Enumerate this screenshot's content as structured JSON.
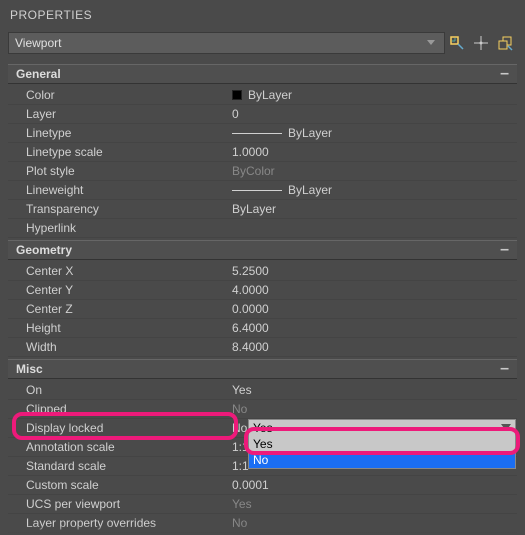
{
  "panel": {
    "title": "PROPERTIES"
  },
  "selector": {
    "value": "Viewport"
  },
  "toolbar": {
    "quickSelect": "quick-select-icon",
    "pim": "pim-icon",
    "toggle": "toggle-icon"
  },
  "general": {
    "header": "General",
    "color_label": "Color",
    "color_value": "ByLayer",
    "layer_label": "Layer",
    "layer_value": "0",
    "linetype_label": "Linetype",
    "linetype_value": "ByLayer",
    "linetype_scale_label": "Linetype scale",
    "linetype_scale_value": "1.0000",
    "plot_style_label": "Plot style",
    "plot_style_value": "ByColor",
    "lineweight_label": "Lineweight",
    "lineweight_value": "ByLayer",
    "transparency_label": "Transparency",
    "transparency_value": "ByLayer",
    "hyperlink_label": "Hyperlink",
    "hyperlink_value": ""
  },
  "geometry": {
    "header": "Geometry",
    "center_x_label": "Center X",
    "center_x_value": "5.2500",
    "center_y_label": "Center Y",
    "center_y_value": "4.0000",
    "center_z_label": "Center Z",
    "center_z_value": "0.0000",
    "height_label": "Height",
    "height_value": "6.4000",
    "width_label": "Width",
    "width_value": "8.4000"
  },
  "misc": {
    "header": "Misc",
    "on_label": "On",
    "on_value": "Yes",
    "clipped_label": "Clipped",
    "clipped_value": "No",
    "display_locked_label": "Display locked",
    "display_locked_value": "No",
    "display_locked_dropdown": {
      "selected": "Yes",
      "opt_yes": "Yes",
      "opt_no": "No"
    },
    "annotation_scale_label": "Annotation scale",
    "annotation_scale_value": "1:1",
    "standard_scale_label": "Standard scale",
    "standard_scale_value": "1:1",
    "custom_scale_label": "Custom scale",
    "custom_scale_value": "0.0001",
    "ucs_per_viewport_label": "UCS per viewport",
    "ucs_per_viewport_value": "Yes",
    "layer_overrides_label": "Layer property overrides",
    "layer_overrides_value": "No"
  }
}
